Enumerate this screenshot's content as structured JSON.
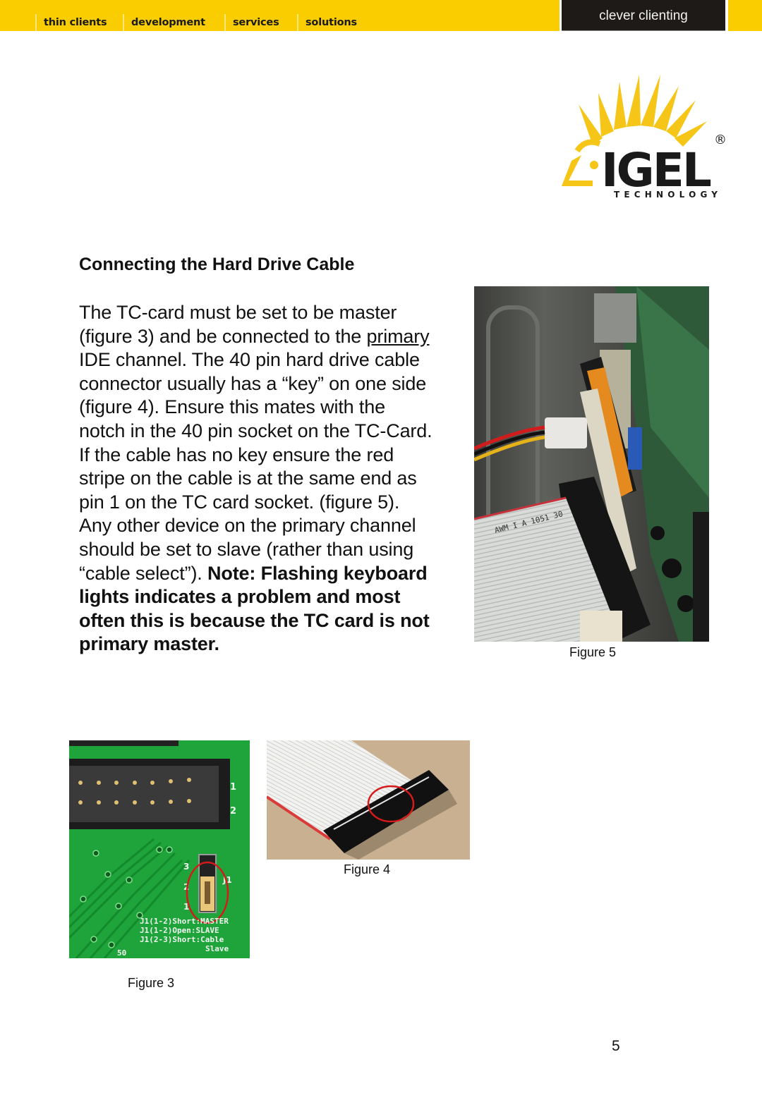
{
  "header": {
    "nav": [
      "thin clients",
      "development",
      "services",
      "solutions"
    ],
    "tagline": "clever clienting",
    "colors": {
      "bar": "#f9cd00",
      "tagline_bg": "#1e1a17"
    }
  },
  "logo": {
    "name": "IGEL",
    "registered": "®",
    "subtitle": "TECHNOLOGY",
    "colors": {
      "rays": "#f5c518",
      "text": "#1a1a1a"
    }
  },
  "content": {
    "heading": "Connecting the Hard Drive Cable",
    "lines": [
      {
        "pre": "The TC-card must be set to be master"
      },
      {
        "pre": "(figure 3) and be connected to the ",
        "underline": "primary"
      },
      {
        "pre": "IDE channel.  The 40 pin hard drive cable"
      },
      {
        "pre": "connector usually has a “key” on one side"
      },
      {
        "pre": "(figure 4).  Ensure this mates with the"
      },
      {
        "pre": "notch in the 40 pin socket on the TC-Card."
      },
      {
        "pre": "If the cable has no key ensure the red"
      },
      {
        "pre": "stripe on the cable is at the same end as"
      },
      {
        "pre": "pin 1 on the TC card socket. (figure 5)."
      },
      {
        "pre": "Any other device on the primary channel"
      },
      {
        "pre": "should be set to slave (rather than using"
      },
      {
        "pre": "“cable select”).  ",
        "bold": "Note: Flashing keyboard"
      },
      {
        "bold": "lights indicates a problem and most"
      },
      {
        "bold": "often this is because the TC card is not"
      },
      {
        "bold": "primary master."
      }
    ]
  },
  "figures": {
    "fig5": {
      "caption": "Figure 5",
      "alt": "TC-card installed in IDE slot with ribbon cable and power connector",
      "cable_print": "AWM I A 1051 30"
    },
    "fig3": {
      "caption": "Figure 3",
      "alt": "TC-card PCB jumper J1 set to master",
      "pin_labels": [
        "1",
        "2"
      ],
      "jumper_pins": [
        "3",
        "2",
        "1"
      ],
      "jumper_name": "J1",
      "silkscreen": [
        "J1(1-2)Short:MASTER",
        "J1(1-2)Open:SLAVE",
        "J1(2-3)Short:Cable",
        "Slave"
      ],
      "corner_label": "50"
    },
    "fig4": {
      "caption": "Figure 4",
      "alt": "40 pin IDE ribbon cable connector with key circled"
    }
  },
  "footer": {
    "page_number": "5"
  }
}
